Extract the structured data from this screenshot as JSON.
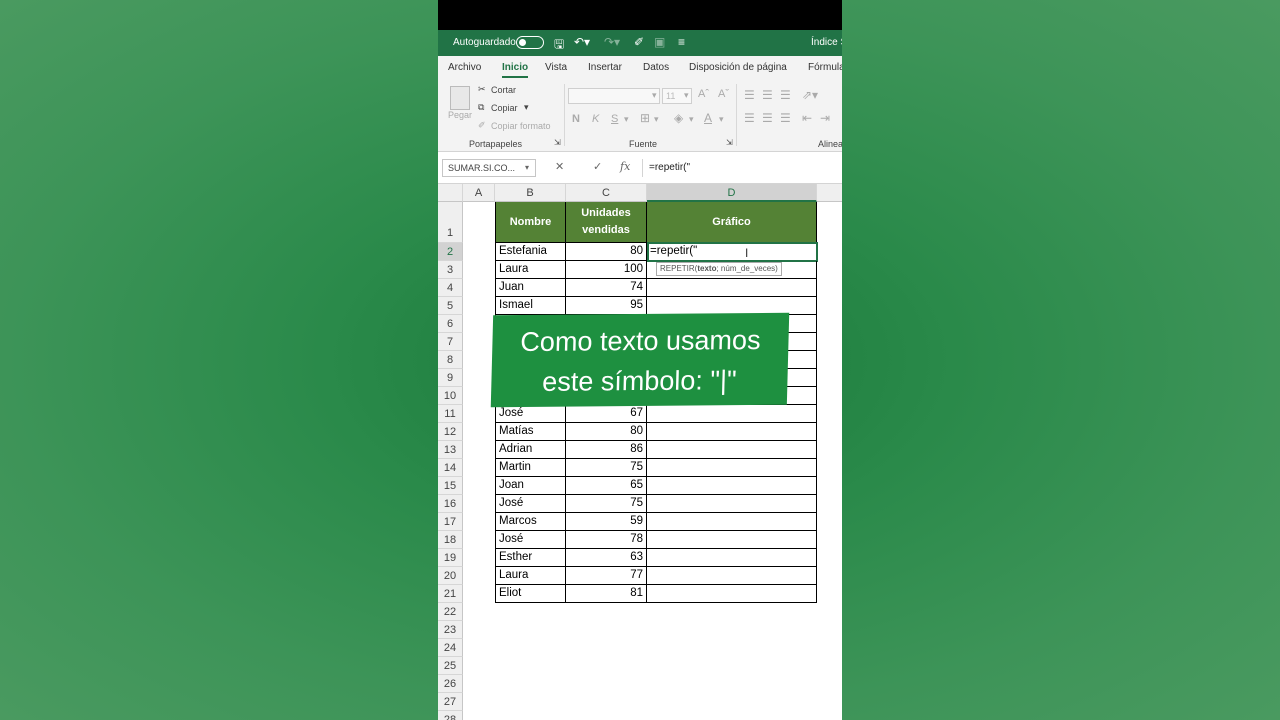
{
  "titlebar": {
    "autosave_label": "Autoguardado",
    "doc_title": "Índice S"
  },
  "menu": {
    "tabs": [
      "Archivo",
      "Inicio",
      "Vista",
      "Insertar",
      "Datos",
      "Disposición de página",
      "Fórmula"
    ],
    "active_tab": "Inicio"
  },
  "ribbon": {
    "paste_label": "Pegar",
    "cut_label": "Cortar",
    "copy_label": "Copiar",
    "format_painter_label": "Copiar formato",
    "clipboard_group": "Portapapeles",
    "font_size": "11",
    "bold": "N",
    "italic": "K",
    "underline": "S",
    "font_group": "Fuente",
    "align_group": "Alinea"
  },
  "formula_bar": {
    "name_box": "SUMAR.SI.CO...",
    "cancel_glyph": "✕",
    "enter_glyph": "✓",
    "fx": "fx",
    "formula": "=repetir(\""
  },
  "sheet": {
    "columns": [
      "A",
      "B",
      "C",
      "D"
    ],
    "active_column": "D",
    "header": {
      "name": "Nombre",
      "units_line1": "Unidades",
      "units_line2": "vendidas",
      "chart": "Gráfico"
    },
    "rows": [
      {
        "n": "2",
        "name": "Estefania",
        "units": "80"
      },
      {
        "n": "3",
        "name": "Laura",
        "units": "100"
      },
      {
        "n": "4",
        "name": "Juan",
        "units": "74"
      },
      {
        "n": "5",
        "name": "Ismael",
        "units": "95"
      },
      {
        "n": "6",
        "name": "",
        "units": ""
      },
      {
        "n": "7",
        "name": "",
        "units": ""
      },
      {
        "n": "8",
        "name": "",
        "units": ""
      },
      {
        "n": "9",
        "name": "",
        "units": ""
      },
      {
        "n": "10",
        "name": "",
        "units": ""
      },
      {
        "n": "11",
        "name": "José",
        "units": "67"
      },
      {
        "n": "12",
        "name": "Matías",
        "units": "80"
      },
      {
        "n": "13",
        "name": "Adrian",
        "units": "86"
      },
      {
        "n": "14",
        "name": "Martin",
        "units": "75"
      },
      {
        "n": "15",
        "name": "Joan",
        "units": "65"
      },
      {
        "n": "16",
        "name": "José",
        "units": "75"
      },
      {
        "n": "17",
        "name": "Marcos",
        "units": "59"
      },
      {
        "n": "18",
        "name": "José",
        "units": "78"
      },
      {
        "n": "19",
        "name": "Esther",
        "units": "63"
      },
      {
        "n": "20",
        "name": "Laura",
        "units": "77"
      },
      {
        "n": "21",
        "name": "Eliot",
        "units": "81"
      }
    ],
    "empty_rows": [
      "22",
      "23",
      "24",
      "25",
      "26",
      "27",
      "28"
    ],
    "active_cell_content": "=repetir(\"",
    "tooltip_func": "REPETIR(",
    "tooltip_arg1": "texto",
    "tooltip_rest": "; núm_de_veces)"
  },
  "overlay": {
    "line1": "Como texto usamos",
    "line2": "este símbolo: \"|\""
  },
  "colors": {
    "excel_green": "#217346",
    "header_green": "#548235",
    "overlay_green": "#1e9040"
  }
}
